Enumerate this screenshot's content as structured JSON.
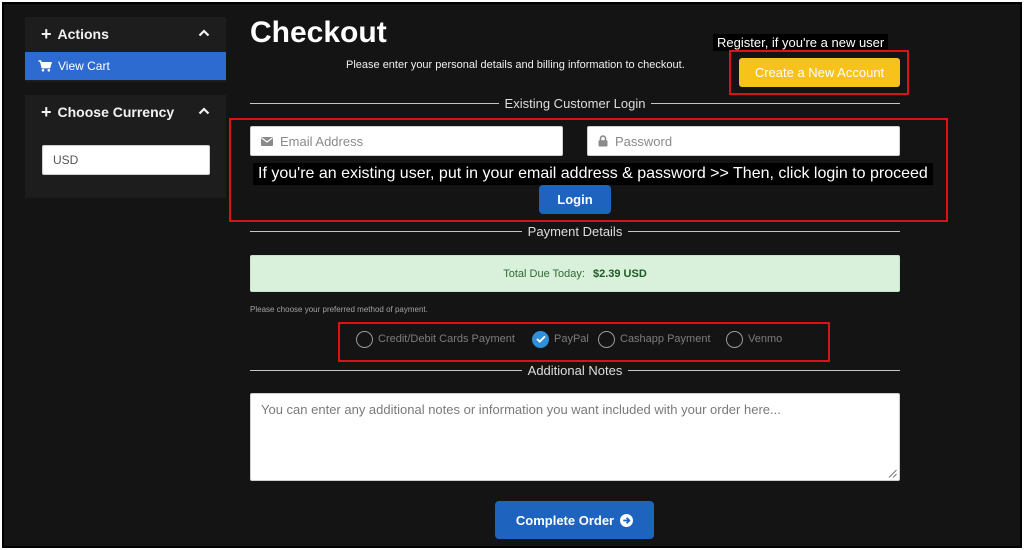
{
  "sidebar": {
    "actions": {
      "title": "Actions",
      "items": [
        {
          "label": "View Cart",
          "icon": "cart-icon"
        }
      ]
    },
    "currency": {
      "title": "Choose Currency",
      "value": "USD"
    }
  },
  "page": {
    "title": "Checkout",
    "intro": "Please enter your personal details and billing information to checkout.",
    "register_callout": "Register, if you're a new user",
    "create_account_label": "Create a New Account"
  },
  "login": {
    "section_title": "Existing Customer Login",
    "email_placeholder": "Email Address",
    "password_placeholder": "Password",
    "callout": "If you're an existing user, put in your email address & password >> Then, click login to proceed",
    "button_label": "Login"
  },
  "payment": {
    "section_title": "Payment Details",
    "total_label": "Total Due Today:",
    "total_amount": "$2.39 USD",
    "method_hint": "Please choose your preferred method of payment.",
    "methods": [
      {
        "label": "Credit/Debit Cards Payment",
        "selected": false
      },
      {
        "label": "PayPal",
        "selected": true
      },
      {
        "label": "Cashapp Payment",
        "selected": false
      },
      {
        "label": "Venmo",
        "selected": false
      }
    ]
  },
  "notes": {
    "section_title": "Additional Notes",
    "placeholder": "You can enter any additional notes or information you want included with your order here..."
  },
  "complete_order_label": "Complete Order",
  "colors": {
    "background": "#141414",
    "panel": "#1d1d1d",
    "primary_blue": "#1e63bd",
    "nav_active": "#2e6bd0",
    "accent_yellow": "#f7c21c",
    "annotation_red": "#d8141a",
    "total_bg": "#d9f0da",
    "radio_checked": "#2f8fd8"
  }
}
